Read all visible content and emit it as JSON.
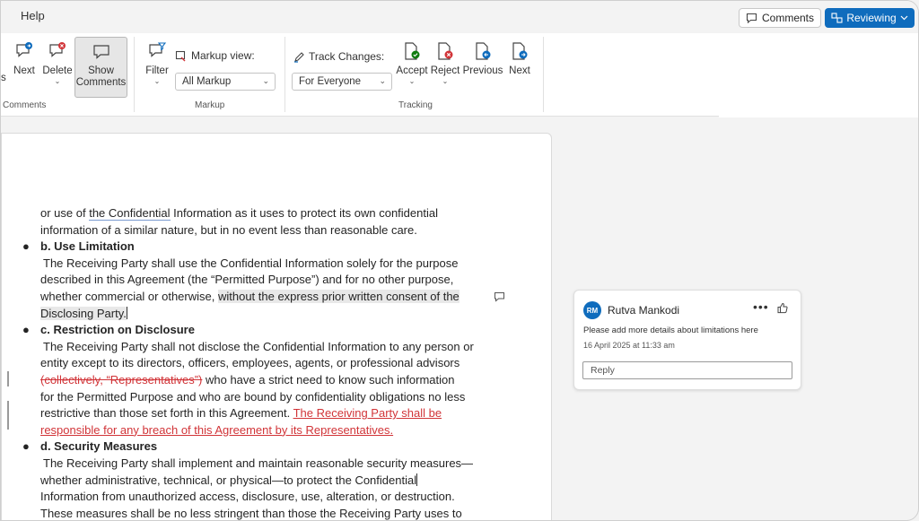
{
  "topbar": {
    "help_label": "Help",
    "comments_label": "Comments",
    "reviewing_label": "Reviewing"
  },
  "ribbon": {
    "comments_group": {
      "partial_label": "s",
      "next_label": "Next",
      "delete_label": "Delete",
      "show_comments_line1": "Show",
      "show_comments_line2": "Comments",
      "group_label": "Comments"
    },
    "markup_group": {
      "filter_label": "Filter",
      "markup_view_label": "Markup view:",
      "markup_view_value": "All Markup",
      "group_label": "Markup"
    },
    "tracking_group": {
      "track_changes_label": "Track Changes:",
      "track_changes_value": "For Everyone",
      "accept_label": "Accept",
      "reject_label": "Reject",
      "previous_label": "Previous",
      "next_label": "Next",
      "group_label": "Tracking"
    }
  },
  "document": {
    "para1_line1_pre": "or use of ",
    "para1_line1_link": "the Confidential",
    "para1_line1_post": " Information as it uses to protect its own confidential",
    "para1_line2": "information of a similar nature, but in no event less than reasonable care.",
    "sec_b_heading": "b. Use Limitation",
    "sec_b_line1": " The Receiving Party shall use the Confidential Information solely for the purpose",
    "sec_b_line2": "described in this Agreement (the “Permitted Purpose”) and for no other purpose,",
    "sec_b_line3_pre": "whether commercial or otherwise, ",
    "sec_b_line3_hl": "without the express prior written consent of the",
    "sec_b_line4_hl": "Disclosing Party.",
    "sec_c_heading": "c. Restriction on Disclosure",
    "sec_c_line1": " The Receiving Party shall not disclose the Confidential Information to any person or",
    "sec_c_line2": "entity except to its directors, officers, employees, agents, or professional advisors",
    "sec_c_line3_del": "(collectively, “Representatives”)",
    "sec_c_line3_post": " who have a strict need to know such information",
    "sec_c_line4": "for the Permitted Purpose and who are bound by confidentiality obligations no less",
    "sec_c_line5_pre": "restrictive than those set forth in this Agreement. ",
    "sec_c_line5_ins": "The Receiving Party shall be",
    "sec_c_line6_ins": "responsible for any breach of this Agreement by its Representatives.",
    "sec_d_heading": "d. Security Measures",
    "sec_d_line1": " The Receiving Party shall implement and maintain reasonable security measures—",
    "sec_d_line2": "whether administrative, technical, or physical—to protect the Confidential",
    "sec_d_line3": "Information from unauthorized access, disclosure, use, alteration, or destruction.",
    "sec_d_line4": "These measures shall be no less stringent than those the Receiving Party uses to"
  },
  "comment": {
    "initials": "RM",
    "author": "Rutva Mankodi",
    "more_label": "•••",
    "text": "Please add more details about limitations here",
    "timestamp": "16 April 2025 at 11:33 am",
    "reply_placeholder": "Reply"
  },
  "colors": {
    "accent": "#0f6cbd",
    "tracked_change": "#d13438"
  }
}
